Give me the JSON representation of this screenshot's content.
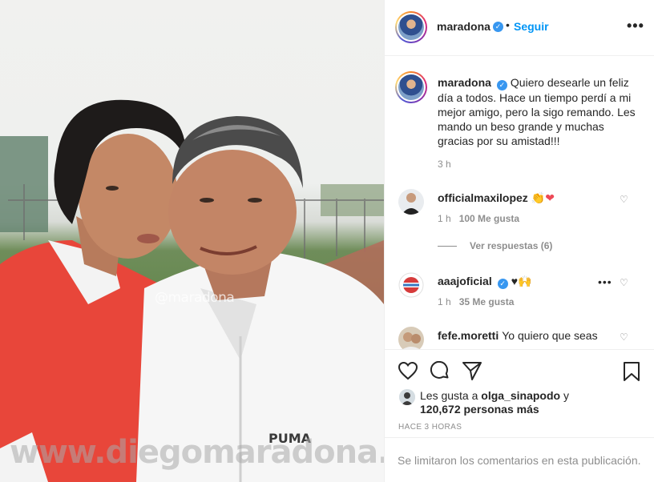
{
  "photo": {
    "watermark_handle": "@maradona",
    "watermark_site": "www.diegomaradona.com",
    "jacket_brand": "PUMA"
  },
  "header": {
    "username": "maradona",
    "follow_label": "Seguir",
    "separator": "•",
    "more_glyph": "•••"
  },
  "caption": {
    "username": "maradona",
    "text": "Quiero desearle un feliz día a todos. Hace un tiempo perdí a mi mejor amigo, pero la sigo remando. Les mando un beso grande y muchas gracias por su amistad!!!",
    "time": "3 h"
  },
  "comments": [
    {
      "username": "officialmaxilopez",
      "text": "",
      "emoji": "👏❤",
      "time": "1 h",
      "likes": "100 Me gusta"
    },
    {
      "username": "aaajoficial",
      "text": "",
      "emoji": "♥🙌",
      "time": "1 h",
      "likes": "35 Me gusta"
    },
    {
      "username": "fefe.moretti",
      "text": "Yo quiero que seas",
      "time": "",
      "likes": ""
    }
  ],
  "replies_label": "Ver respuestas (6)",
  "likes_summary": {
    "prefix": "Les gusta a ",
    "user": "olga_sinapodo",
    "middle": " y ",
    "count": "120,672 personas más"
  },
  "time_ago": "HACE 3 HORAS",
  "footer_message": "Se limitaron los comentarios en esta publicación.",
  "colors": {
    "link_blue": "#0095f6",
    "verified_blue": "#3897f0",
    "heart_red": "#ed4956",
    "text_gray": "#8e8e8e"
  },
  "icons": [
    "heart-icon",
    "comment-icon",
    "share-icon",
    "bookmark-icon",
    "verified-icon",
    "more-icon"
  ]
}
